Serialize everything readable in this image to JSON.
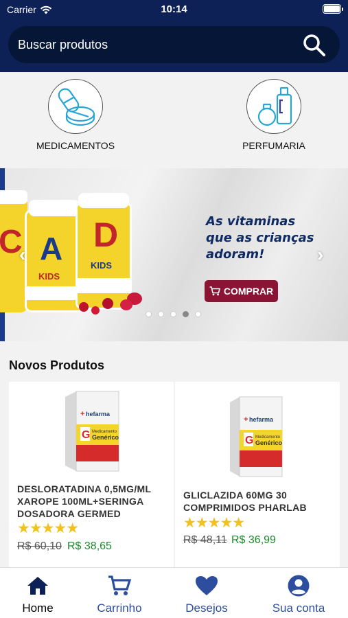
{
  "status_bar": {
    "carrier": "Carrier",
    "time": "10:14"
  },
  "search": {
    "placeholder": "Buscar produtos"
  },
  "categories": [
    {
      "label": "MEDICAMENTOS",
      "icon": "pills-icon"
    },
    {
      "label": "PERFUMARIA",
      "icon": "perfume-icon"
    }
  ],
  "banner": {
    "headline_line1": "As vitaminas",
    "headline_line2": "que as crianças",
    "headline_line3": "adoram!",
    "button_label": "COMPRAR",
    "jar_letters": [
      "C",
      "A",
      "D"
    ],
    "jar_kids": "KIDS",
    "slide_count": 5,
    "active_slide": 4
  },
  "products_section": {
    "title": "Novos Produtos"
  },
  "products": [
    {
      "name_line1": "DESLORATADINA 0,5MG/ML",
      "name_line2": "XAROPE 100ML+SERINGA",
      "name_line3": "DOSADORA GERMED",
      "rating": 5,
      "old_price": "R$ 60,10",
      "price": "R$ 38,65",
      "brand": "hefarma",
      "generic": "Genérico"
    },
    {
      "name_line1": "GLICLAZIDA 60MG 30",
      "name_line2": "COMPRIMIDOS PHARLAB",
      "name_line3": "",
      "rating": 5,
      "old_price": "R$ 48,11",
      "price": "R$ 36,99",
      "brand": "hefarma",
      "generic": "Genérico"
    }
  ],
  "tabs": [
    {
      "label": "Home",
      "icon": "home-icon",
      "active": true
    },
    {
      "label": "Carrinho",
      "icon": "cart-icon",
      "active": false
    },
    {
      "label": "Desejos",
      "icon": "heart-icon",
      "active": false
    },
    {
      "label": "Sua conta",
      "icon": "account-icon",
      "active": false
    }
  ],
  "colors": {
    "header": "#0d2157",
    "tab_accent": "#2d4e9e",
    "price_green": "#1a8a2a",
    "star": "#f2c21b",
    "buy_button": "#8b1434"
  }
}
